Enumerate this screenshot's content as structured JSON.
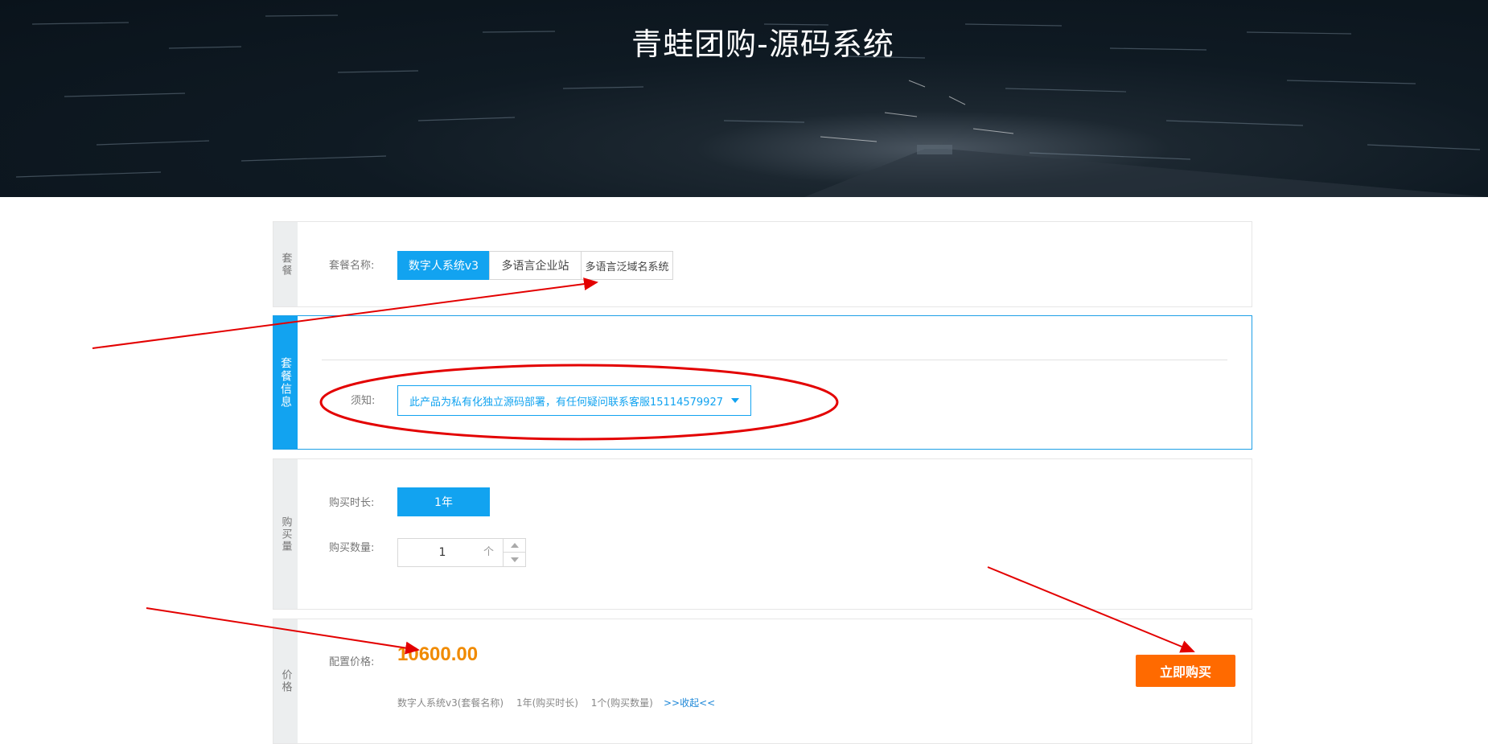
{
  "banner": {
    "title": "青蛙团购-源码系统"
  },
  "package_section": {
    "side_label": "套餐",
    "name_label": "套餐名称:",
    "options": [
      "数字人系统v3",
      "多语言企业站",
      "多语言泛域名系统"
    ]
  },
  "info_section": {
    "side_label": "套餐信息",
    "notice_label": "须知:",
    "notice_text": "此产品为私有化独立源码部署，有任何疑问联系客服15114579927"
  },
  "purchase_section": {
    "side_label": "购买量",
    "duration_label": "购买时长:",
    "duration_option": "1年",
    "quantity_label": "购买数量:",
    "quantity_value": "1",
    "quantity_unit": "个"
  },
  "price_section": {
    "side_label": "价格",
    "price_label": "配置价格:",
    "price_value": "10600.00",
    "summary": [
      "数字人系统v3(套餐名称)",
      "1年(购买时长)",
      "1个(购买数量)"
    ],
    "collapse_link": ">>收起<<",
    "buy_button": "立即购买"
  },
  "colors": {
    "accent": "#12a3f0",
    "price": "#f08a00",
    "buy": "#ff6a00",
    "annotation": "#e30000"
  }
}
